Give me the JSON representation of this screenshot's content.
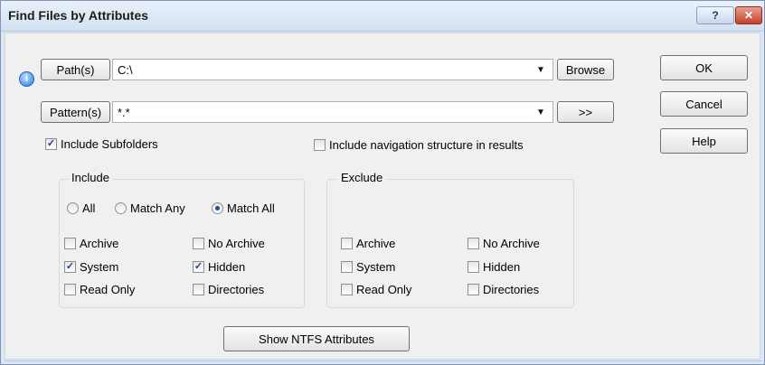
{
  "window": {
    "title": "Find Files by Attributes",
    "help_btn": "?",
    "close_btn": "✕"
  },
  "paths": {
    "button": "Path(s)",
    "value": "C:\\",
    "browse": "Browse"
  },
  "patterns": {
    "button": "Pattern(s)",
    "value": "*.*",
    "more": ">>",
    "info_icon": "i"
  },
  "actions": {
    "ok": "OK",
    "cancel": "Cancel",
    "help": "Help"
  },
  "options": {
    "include_subfolders": "Include Subfolders",
    "include_subfolders_checked": true,
    "include_navigation": "Include navigation structure in results",
    "include_navigation_checked": false
  },
  "include": {
    "label": "Include",
    "radios": [
      {
        "label": "All",
        "selected": false
      },
      {
        "label": "Match Any",
        "selected": false
      },
      {
        "label": "Match All",
        "selected": true
      }
    ],
    "checks": [
      {
        "label": "Archive",
        "checked": false
      },
      {
        "label": "No Archive",
        "checked": false
      },
      {
        "label": "System",
        "checked": true
      },
      {
        "label": "Hidden",
        "checked": true
      },
      {
        "label": "Read Only",
        "checked": false
      },
      {
        "label": "Directories",
        "checked": false
      }
    ]
  },
  "exclude": {
    "label": "Exclude",
    "checks": [
      {
        "label": "Archive",
        "checked": false
      },
      {
        "label": "No Archive",
        "checked": false
      },
      {
        "label": "System",
        "checked": false
      },
      {
        "label": "Hidden",
        "checked": false
      },
      {
        "label": "Read Only",
        "checked": false
      },
      {
        "label": "Directories",
        "checked": false
      }
    ]
  },
  "ntfs_button": "Show NTFS Attributes",
  "colors": {
    "title_bg": "#dce7f4",
    "dialog_bg": "#f0f0f0",
    "check_mark": "#1e3f8a",
    "close_red": "#c4432a"
  },
  "icons": {
    "dropdown": "▼",
    "checkmark": "✓"
  }
}
